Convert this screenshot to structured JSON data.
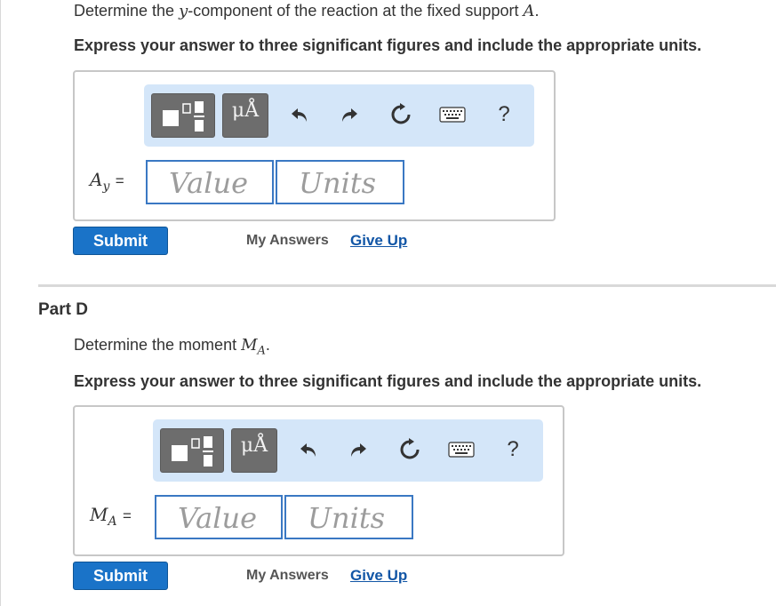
{
  "part_c": {
    "prompt_before": "Determine the ",
    "prompt_var": "y",
    "prompt_middle": "-component of the reaction at the fixed support ",
    "prompt_support": "A",
    "prompt_after": ".",
    "instruction": "Express your answer to three significant figures and include the appropriate units.",
    "field_var": "A",
    "field_sub": "y",
    "equals": "=",
    "value_placeholder": "Value",
    "units_placeholder": "Units",
    "submit_label": "Submit",
    "my_answers_label": "My Answers",
    "give_up_label": "Give Up"
  },
  "part_d": {
    "title": "Part D",
    "prompt_before": "Determine the moment ",
    "prompt_var": "M",
    "prompt_sub": "A",
    "prompt_after": ".",
    "instruction": "Express your answer to three significant figures and include the appropriate units.",
    "field_var": "M",
    "field_sub": "A",
    "equals": "=",
    "value_placeholder": "Value",
    "units_placeholder": "Units",
    "submit_label": "Submit",
    "my_answers_label": "My Answers",
    "give_up_label": "Give Up"
  },
  "toolbar": {
    "units_symbol_label": "μÅ",
    "help_label": "?",
    "icons": [
      "templates-icon",
      "units-icon",
      "undo-icon",
      "redo-icon",
      "reset-icon",
      "keyboard-icon",
      "help-icon"
    ]
  },
  "colors": {
    "toolbar_bg": "#d4e6f9",
    "toolbar_button": "#6d6d6d",
    "input_border": "#3a78c3",
    "submit_bg": "#1a73c8",
    "link": "#1256a6"
  }
}
